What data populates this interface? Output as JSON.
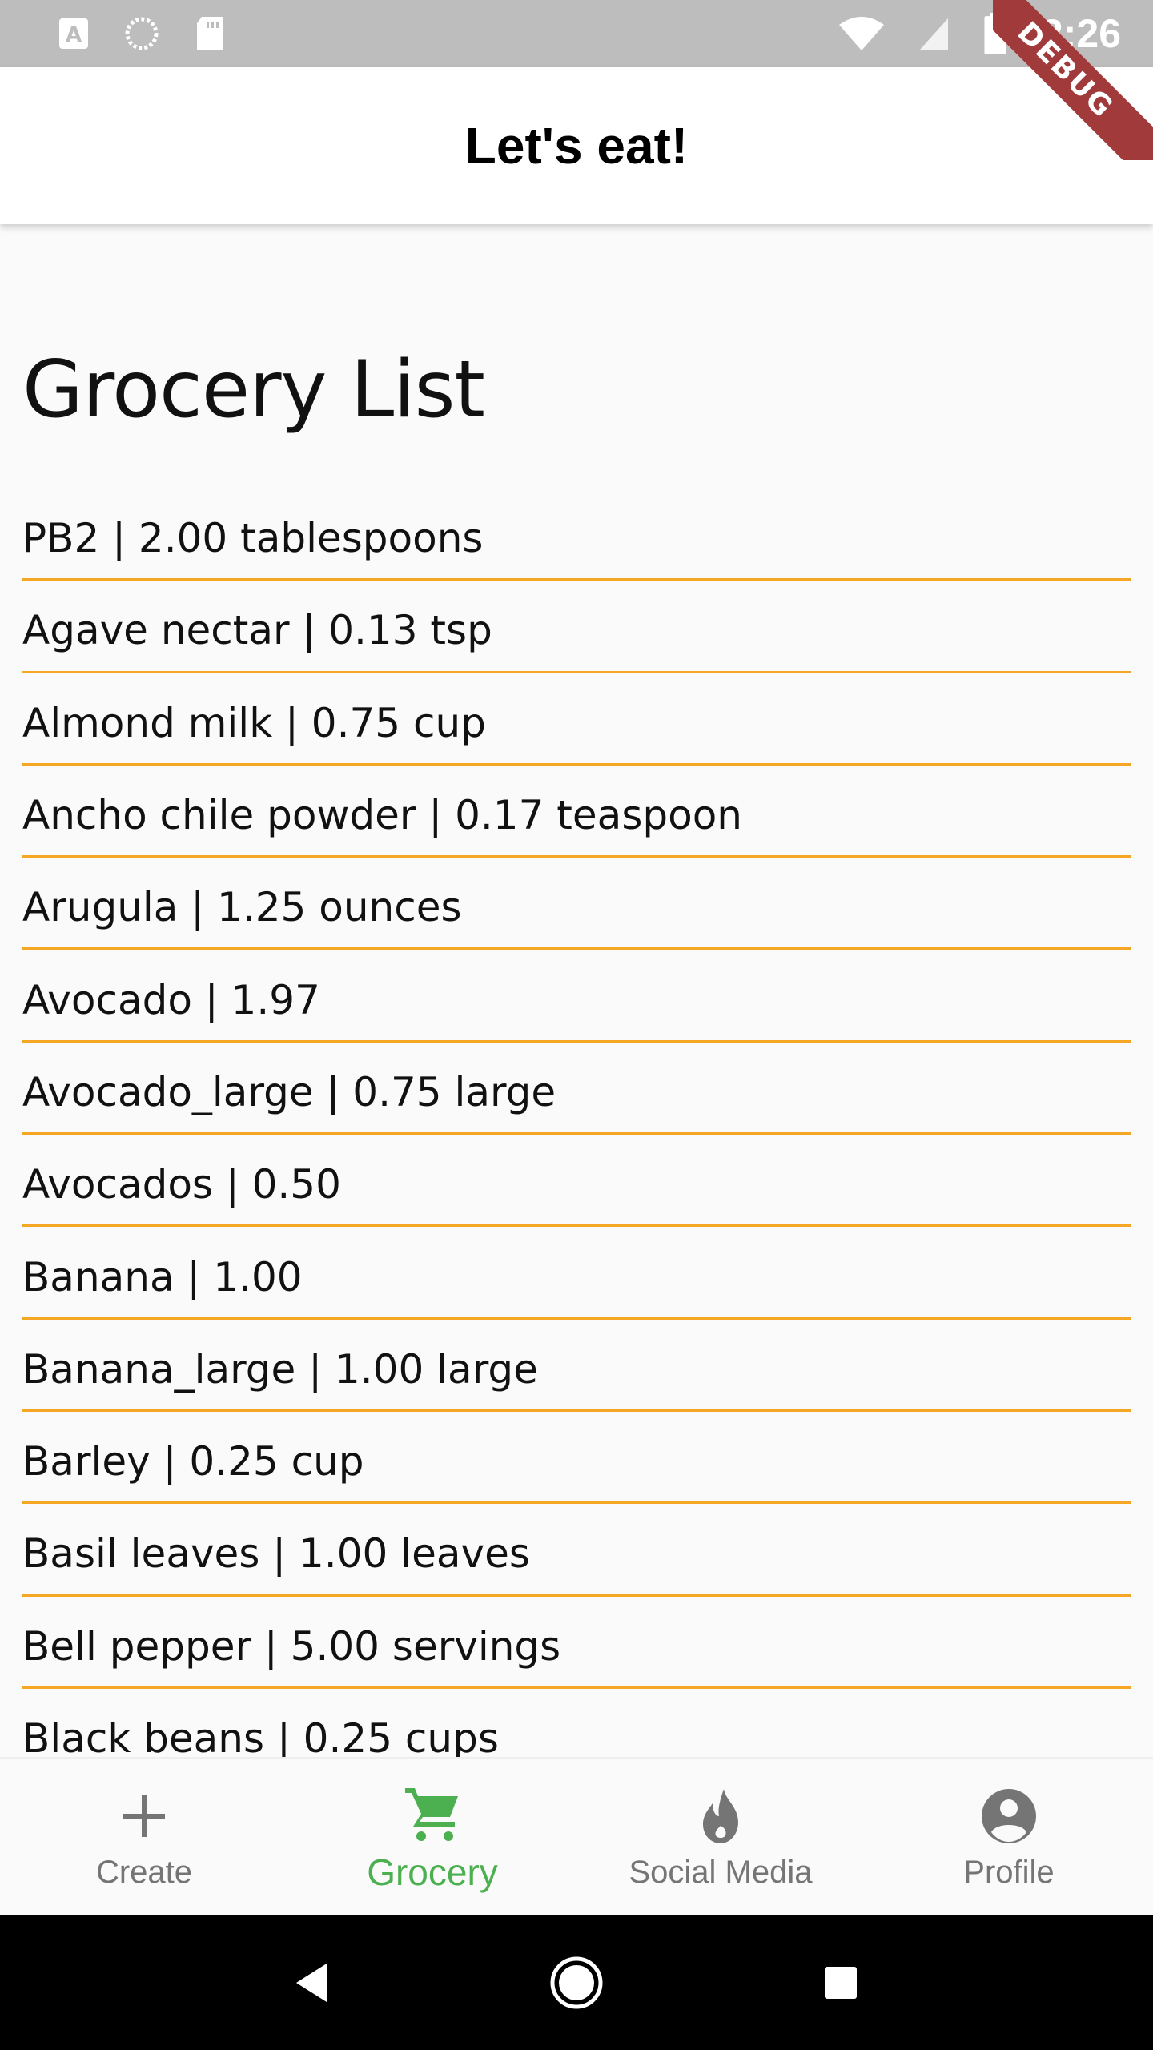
{
  "status_bar": {
    "time": "2:26",
    "left_icons": [
      "a-box-icon",
      "loading-icon",
      "sd-card-icon"
    ],
    "right_icons": [
      "wifi-icon",
      "signal-icon",
      "battery-icon"
    ]
  },
  "app_bar": {
    "title": "Let's eat!",
    "debug_label": "DEBUG"
  },
  "page": {
    "title": "Grocery List"
  },
  "grocery_items": [
    "PB2 | 2.00 tablespoons",
    "Agave nectar | 0.13 tsp",
    "Almond milk | 0.75 cup",
    "Ancho chile powder | 0.17 teaspoon",
    "Arugula | 1.25 ounces",
    "Avocado | 1.97",
    "Avocado_large | 0.75 large",
    "Avocados | 0.50",
    "Banana | 1.00",
    "Banana_large | 1.00 large",
    "Barley | 0.25 cup",
    "Basil leaves | 1.00 leaves",
    "Bell pepper | 5.00 servings",
    "Black beans | 0.25 cups"
  ],
  "bottom_nav": {
    "items": [
      {
        "label": "Create",
        "icon": "plus-icon",
        "active": false
      },
      {
        "label": "Grocery",
        "icon": "cart-icon",
        "active": true
      },
      {
        "label": "Social Media",
        "icon": "flame-icon",
        "active": false
      },
      {
        "label": "Profile",
        "icon": "account-circle-icon",
        "active": false
      }
    ]
  },
  "colors": {
    "accent_active": "#4caf50",
    "divider": "#f5a623",
    "status_bar": "#bdbdbd",
    "debug_ribbon": "#a13a3a"
  }
}
